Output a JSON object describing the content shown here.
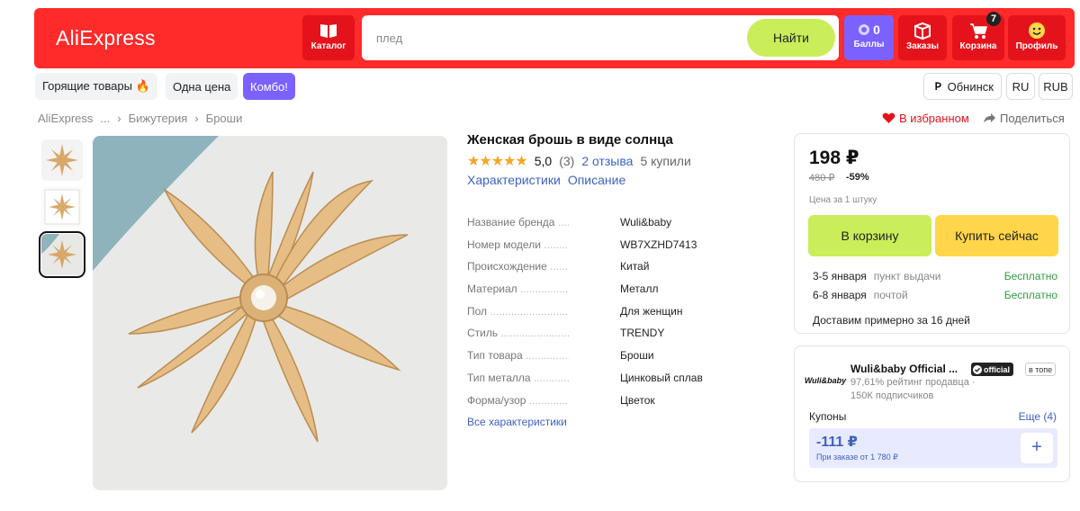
{
  "header": {
    "logo": "AliExpress",
    "catalog_label": "Каталог",
    "search_placeholder": "плед",
    "search_button": "Найти",
    "points_value": "0",
    "points_label": "Баллы",
    "orders_label": "Заказы",
    "cart_label": "Корзина",
    "cart_count": "7",
    "profile_label": "Профиль"
  },
  "chips": {
    "hot": "Горящие товары 🔥",
    "one_price": "Одна цена",
    "combo": "Комбо!",
    "city": "Обнинск",
    "lang": "RU",
    "currency": "RUB"
  },
  "breadcrumb": [
    "AliExpress",
    "...",
    "Бижутерия",
    "Броши"
  ],
  "actions": {
    "favorite": "В избранном",
    "share": "Поделиться"
  },
  "product": {
    "title": "Женская брошь в виде солнца",
    "rating": "5,0",
    "rating_count": "(3)",
    "reviews": "2 отзыва",
    "bought": "5 купили",
    "tab_specs": "Характеристики",
    "tab_desc": "Описание",
    "specs": [
      {
        "key": "Название бренда",
        "value": "Wuli&baby"
      },
      {
        "key": "Номер модели",
        "value": "WB7XZHD7413"
      },
      {
        "key": "Происхождение",
        "value": "Китай"
      },
      {
        "key": "Материал",
        "value": "Металл"
      },
      {
        "key": "Пол",
        "value": "Для женщин"
      },
      {
        "key": "Стиль",
        "value": "TRENDY"
      },
      {
        "key": "Тип товара",
        "value": "Броши"
      },
      {
        "key": "Тип металла",
        "value": "Цинковый сплав"
      },
      {
        "key": "Форма/узор",
        "value": "Цветок"
      }
    ],
    "all_specs": "Все характеристики"
  },
  "buybox": {
    "price": "198 ₽",
    "old_price": "480 ₽",
    "discount": "-59%",
    "unit_note": "Цена за 1 штуку",
    "cart_button": "В корзину",
    "buy_button": "Купить сейчас",
    "delivery": [
      {
        "date": "3-5 января",
        "method": "пункт выдачи",
        "price": "Бесплатно"
      },
      {
        "date": "6-8 января",
        "method": "почтой",
        "price": "Бесплатно"
      }
    ],
    "approx": "Доставим примерно за 16 дней"
  },
  "seller": {
    "logo_text": "Wuli&baby",
    "name": "Wuli&baby Official ...",
    "official_badge": "official",
    "top_badge": "в топе",
    "rating": "97,61% рейтинг продавца  ·",
    "subscribers": "150К подписчиков",
    "coupons_label": "Купоны",
    "coupons_more": "Еще (4)",
    "coupon_amount": "-111 ₽",
    "coupon_condition": "При заказе от 1 780 ₽"
  },
  "colors": {
    "header_red": "#ff2a2a",
    "accent_purple": "#7b61ff",
    "lime": "#c9ee59",
    "yellow": "#ffd54a",
    "link_blue": "#3e62c1",
    "free_green": "#2e9e3f"
  }
}
